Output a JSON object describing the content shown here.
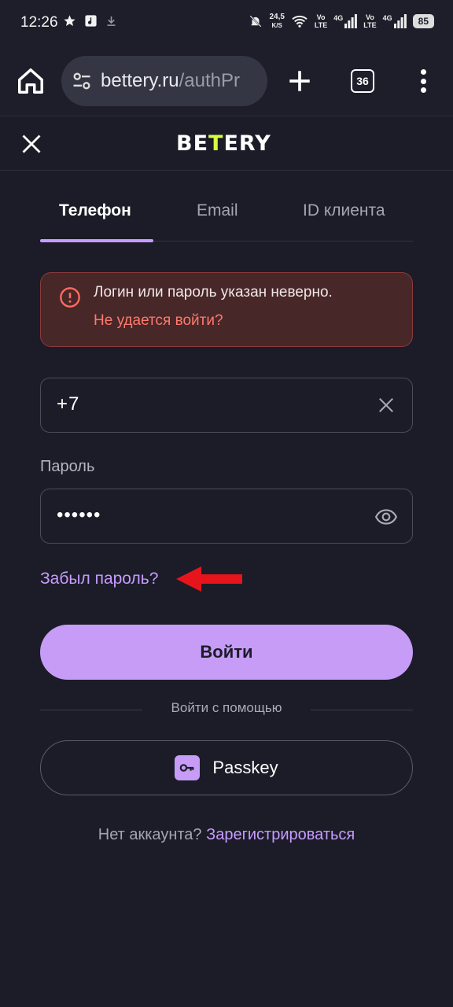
{
  "status_bar": {
    "time": "12:26",
    "net_speed_value": "24,5",
    "net_speed_unit": "K/S",
    "vo1": "Vo",
    "lte1": "LTE",
    "g1": "4G",
    "vo2": "Vo",
    "lte2": "LTE",
    "g2": "4G",
    "battery": "85"
  },
  "browser": {
    "url_main": "bettery.ru",
    "url_path": "/authPr",
    "tab_count": "36"
  },
  "site": {
    "logo_part1": "BE",
    "logo_accent": "T",
    "logo_part2": "ERY"
  },
  "tabs": [
    {
      "label": "Телефон",
      "active": true
    },
    {
      "label": "Email",
      "active": false
    },
    {
      "label": "ID клиента",
      "active": false
    }
  ],
  "error": {
    "message": "Логин или пароль указан неверно.",
    "link": "Не удается войти?"
  },
  "form": {
    "phone_value": "+7",
    "password_label": "Пароль",
    "password_value": "••••••",
    "forgot_link": "Забыл пароль?",
    "submit_label": "Войти",
    "alt_login_label": "Войти с помощью",
    "passkey_label": "Passkey"
  },
  "signup": {
    "prompt": "Нет аккаунта?",
    "link": "Зарегистрироваться"
  },
  "colors": {
    "accent": "#c79cff",
    "button": "#c69cf7",
    "error_bg": "#482729",
    "error_text": "#ff7a6b",
    "background": "#1b1c28",
    "annotation_arrow": "#e8141c"
  }
}
